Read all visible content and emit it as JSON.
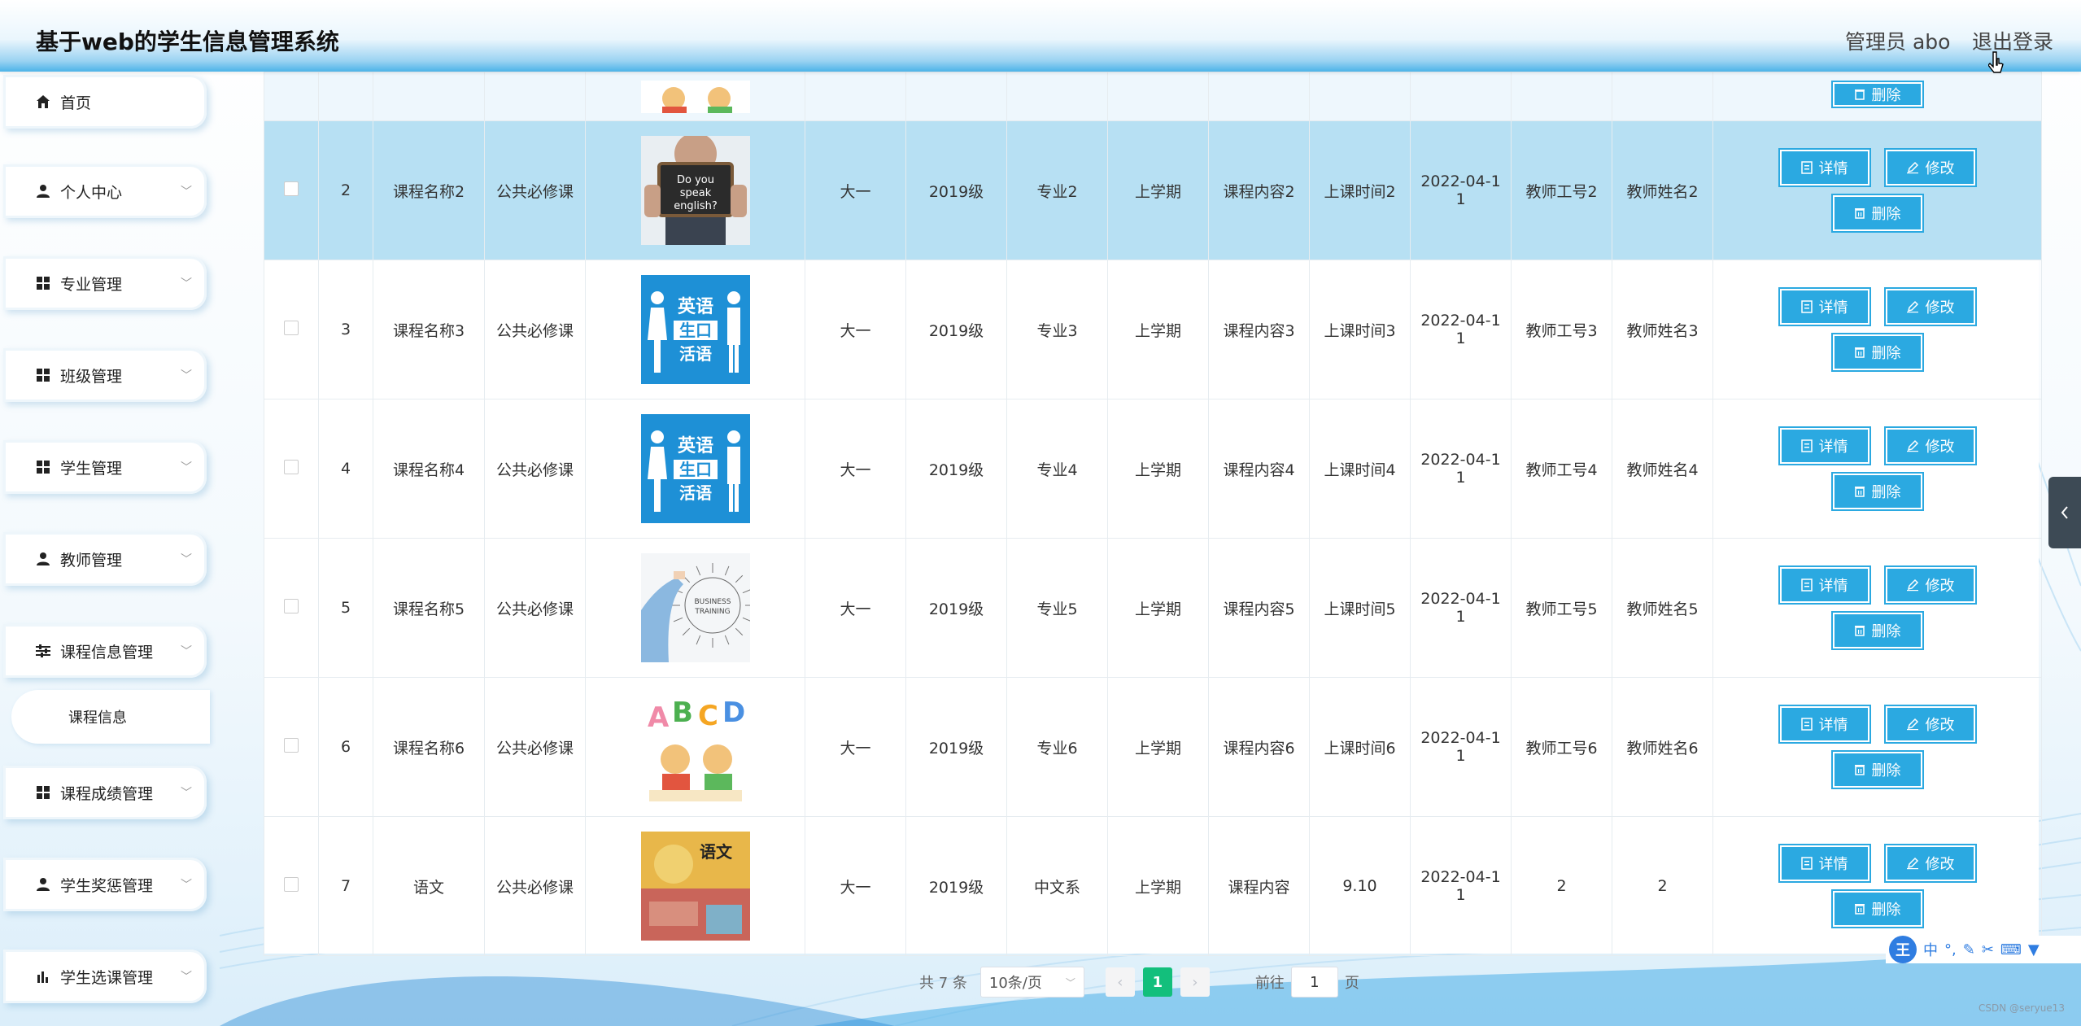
{
  "header": {
    "title": "基于web的学生信息管理系统",
    "admin": "管理员 abo",
    "logout": "退出登录"
  },
  "sidebar": {
    "items": [
      {
        "label": "首页",
        "icon": "home-icon"
      },
      {
        "label": "个人中心",
        "icon": "user-icon"
      },
      {
        "label": "专业管理",
        "icon": "grid-icon"
      },
      {
        "label": "班级管理",
        "icon": "grid-icon"
      },
      {
        "label": "学生管理",
        "icon": "grid-icon"
      },
      {
        "label": "教师管理",
        "icon": "user-icon"
      },
      {
        "label": "课程信息管理",
        "icon": "sliders-icon"
      },
      {
        "label": "课程信息",
        "icon": ""
      },
      {
        "label": "课程成绩管理",
        "icon": "grid-icon"
      },
      {
        "label": "学生奖惩管理",
        "icon": "user-icon"
      },
      {
        "label": "学生选课管理",
        "icon": "bar-chart-icon"
      }
    ]
  },
  "actions": {
    "detail": "详情",
    "edit": "修改",
    "delete": "删除"
  },
  "table": {
    "rows": [
      {
        "no": "2",
        "name": "课程名称2",
        "type": "公共必修课",
        "image": "do-you-speak-english",
        "grade": "大一",
        "year": "2019级",
        "major": "专业2",
        "term": "上学期",
        "content": "课程内容2",
        "time": "上课时间2",
        "date": "2022-04-11",
        "tid": "教师工号2",
        "tname": "教师姓名2"
      },
      {
        "no": "3",
        "name": "课程名称3",
        "type": "公共必修课",
        "image": "english-speaking",
        "grade": "大一",
        "year": "2019级",
        "major": "专业3",
        "term": "上学期",
        "content": "课程内容3",
        "time": "上课时间3",
        "date": "2022-04-11",
        "tid": "教师工号3",
        "tname": "教师姓名3"
      },
      {
        "no": "4",
        "name": "课程名称4",
        "type": "公共必修课",
        "image": "english-speaking",
        "grade": "大一",
        "year": "2019级",
        "major": "专业4",
        "term": "上学期",
        "content": "课程内容4",
        "time": "上课时间4",
        "date": "2022-04-11",
        "tid": "教师工号4",
        "tname": "教师姓名4"
      },
      {
        "no": "5",
        "name": "课程名称5",
        "type": "公共必修课",
        "image": "business-training",
        "grade": "大一",
        "year": "2019级",
        "major": "专业5",
        "term": "上学期",
        "content": "课程内容5",
        "time": "上课时间5",
        "date": "2022-04-11",
        "tid": "教师工号5",
        "tname": "教师姓名5"
      },
      {
        "no": "6",
        "name": "课程名称6",
        "type": "公共必修课",
        "image": "abcd-kids",
        "grade": "大一",
        "year": "2019级",
        "major": "专业6",
        "term": "上学期",
        "content": "课程内容6",
        "time": "上课时间6",
        "date": "2022-04-11",
        "tid": "教师工号6",
        "tname": "教师姓名6"
      },
      {
        "no": "7",
        "name": "语文",
        "type": "公共必修课",
        "image": "chinese-textbook",
        "grade": "大一",
        "year": "2019级",
        "major": "中文系",
        "term": "上学期",
        "content": "课程内容",
        "time": "9.10",
        "date": "2022-04-11",
        "tid": "2",
        "tname": "2"
      }
    ],
    "date_line1": "2022-04-1",
    "date_line2": "1"
  },
  "image_text": {
    "speak": "Do you speak english?",
    "cn_en": "英语",
    "cn_life": "生口",
    "cn_sub": "活语",
    "business": "BUSINESS TRAINING",
    "abcd": "ABCD",
    "textbook": "语文"
  },
  "pagination": {
    "total": "共 7 条",
    "size": "10条/页",
    "current": "1",
    "goto_prefix": "前往",
    "goto_value": "1",
    "goto_suffix": "页"
  },
  "ime": {
    "logo": "王",
    "mode": "中"
  },
  "watermark": "CSDN @seryue13",
  "colors": {
    "accent": "#2ba9e1",
    "highlight_row": "#b7e0f3",
    "pager_active": "#13bf7c"
  }
}
